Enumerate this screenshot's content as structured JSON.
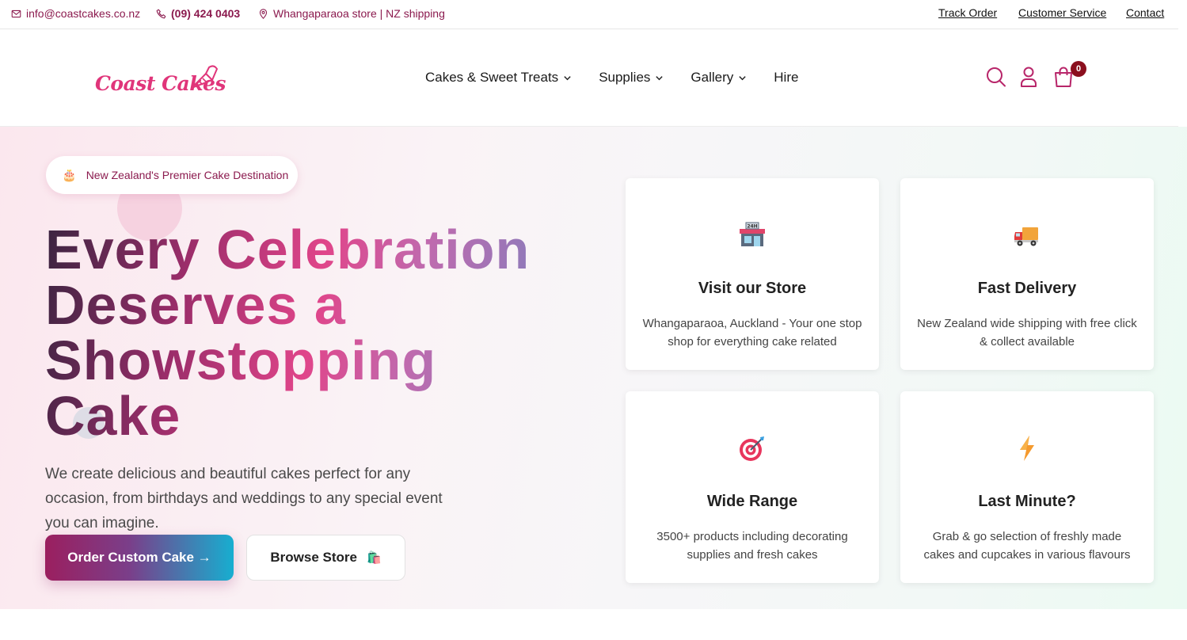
{
  "topbar": {
    "email": "info@coastcakes.co.nz",
    "phone": "(09) 424 0403",
    "store": "Whangaparaoa store | NZ shipping",
    "links": [
      "Track Order",
      "Customer Service",
      "Contact"
    ]
  },
  "header": {
    "logo_text": "Coast Cakes",
    "nav": [
      {
        "label": "Cakes & Sweet Treats",
        "dropdown": true
      },
      {
        "label": "Supplies",
        "dropdown": true
      },
      {
        "label": "Gallery",
        "dropdown": true
      },
      {
        "label": "Hire",
        "dropdown": false
      }
    ],
    "cart_count": "0",
    "icons": [
      "search-icon",
      "account-icon",
      "cart-icon"
    ]
  },
  "hero": {
    "badge_icon": "🎂",
    "badge_text": "New Zealand's Premier Cake Destination",
    "headline": [
      "Every Celebration",
      "Deserves a",
      "Showstopping",
      "Cake"
    ],
    "subtext": "We create delicious and beautiful cakes perfect for any occasion, from birthdays and weddings to any special event you can imagine.",
    "primary_button": "Order Custom Cake →",
    "secondary_button": "Browse Store",
    "secondary_button_icon": "🛍️"
  },
  "features": [
    {
      "icon": "store-24h-icon",
      "title": "Visit our Store",
      "desc": "Whangaparaoa, Auckland - Your one stop shop for everything cake related"
    },
    {
      "icon": "delivery-truck-icon",
      "title": "Fast Delivery",
      "desc": "New Zealand wide shipping with free click & collect available"
    },
    {
      "icon": "target-icon",
      "title": "Wide Range",
      "desc": "3500+ products including decorating supplies and fresh cakes"
    },
    {
      "icon": "lightning-icon",
      "title": "Last Minute?",
      "desc": "Grab & go selection of freshly made cakes and cupcakes in various flavours"
    }
  ],
  "colors": {
    "brand_pink": "#e0357a",
    "brand_plum": "#8b1a4e",
    "badge_red": "#8b0f1e",
    "button_gradient_end": "#17aed0"
  }
}
